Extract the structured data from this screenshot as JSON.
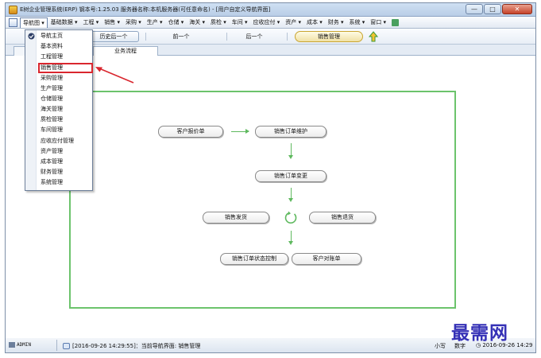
{
  "window": {
    "title": "E树企业管理系统(ERP) 钢本号:1.25.03  服务器名称:本机服务器(可任意命名)  - [用户自定义导航界面]",
    "controls": [
      "—",
      "□",
      "✕"
    ]
  },
  "menubar": {
    "items": [
      {
        "label": "导航图 ▾",
        "name": "menu-navigation"
      },
      {
        "label": "基础数据 ▾",
        "name": "menu-basic-data"
      },
      {
        "label": "工程 ▾",
        "name": "menu-project"
      },
      {
        "label": "销售 ▾",
        "name": "menu-sales"
      },
      {
        "label": "采购 ▾",
        "name": "menu-purchase"
      },
      {
        "label": "生产 ▾",
        "name": "menu-production"
      },
      {
        "label": "仓储 ▾",
        "name": "menu-warehouse"
      },
      {
        "label": "海关 ▾",
        "name": "menu-customs"
      },
      {
        "label": "质检 ▾",
        "name": "menu-quality"
      },
      {
        "label": "车间 ▾",
        "name": "menu-workshop"
      },
      {
        "label": "应收应付 ▾",
        "name": "menu-receivable"
      },
      {
        "label": "资产 ▾",
        "name": "menu-assets"
      },
      {
        "label": "成本 ▾",
        "name": "menu-cost"
      },
      {
        "label": "财务 ▾",
        "name": "menu-finance"
      },
      {
        "label": "系统 ▾",
        "name": "menu-system"
      },
      {
        "label": "窗口 ▾",
        "name": "menu-window"
      }
    ]
  },
  "toolbar": {
    "history_back": "历史后一个",
    "prev": "前一个",
    "next": "后一个",
    "current": "销售管理"
  },
  "tabs": {
    "business_flow": "业务流程"
  },
  "dropdown": {
    "items": [
      "导航主页",
      "基本资料",
      "工程管理",
      "销售管理",
      "采购管理",
      "生产管理",
      "仓储管理",
      "海关管理",
      "质检管理",
      "车间管理",
      "应收应付管理",
      "资产管理",
      "成本管理",
      "财务管理",
      "系统管理"
    ],
    "checked_index": 0,
    "highlighted_index": 3
  },
  "flow": {
    "customer_quote": "客户报价单",
    "order_maintain": "销售订单维护",
    "order_change": "销售订单变更",
    "sales_delivery": "销售发货",
    "sales_return": "销售退货",
    "order_status": "销售订单状态控制",
    "customer_statement": "客户对账单"
  },
  "statusbar": {
    "user": "ADMIN",
    "message": "[2016-09-26 14:29:55]：当前导航界面: 销售管理",
    "caps": "小写",
    "num": "数字",
    "clock": "2016-09-26 14:29"
  },
  "watermark": "最需网",
  "colors": {
    "flow_border": "#6cc36c",
    "highlight": "#d9262e",
    "watermark": "#3531b6"
  }
}
